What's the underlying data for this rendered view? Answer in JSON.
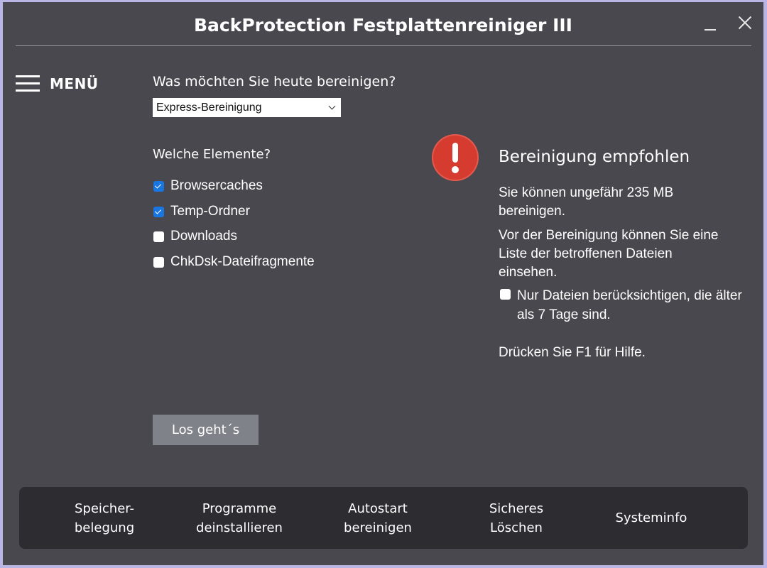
{
  "window": {
    "title": "BackProtection Festplattenreiniger III"
  },
  "menu": {
    "label": "MENÜ"
  },
  "main": {
    "question": "Was möchten Sie heute bereinigen?",
    "mode_select": {
      "value": "Express-Bereinigung"
    },
    "elements_heading": "Welche Elemente?",
    "elements": [
      {
        "label": "Browsercaches",
        "checked": true
      },
      {
        "label": "Temp-Ordner",
        "checked": true
      },
      {
        "label": "Downloads",
        "checked": false
      },
      {
        "label": "ChkDsk-Dateifragmente",
        "checked": false
      }
    ],
    "start_button": "Los geht´s"
  },
  "recommendation": {
    "icon": "exclamation-icon",
    "title": "Bereinigung empfohlen",
    "size_text": "Sie können ungefähr 235 MB bereinigen.",
    "list_text": "Vor der Bereinigung können Sie eine Liste der betroffenen Dateien einsehen.",
    "older_checkbox": {
      "label": "Nur Dateien berücksichtigen, die älter als 7 Tage sind.",
      "checked": false
    },
    "help_text": "Drücken Sie F1 für Hilfe."
  },
  "bottom_nav": [
    {
      "label": "Speicher-\nbelegung"
    },
    {
      "label": "Programme\ndeinstallieren"
    },
    {
      "label": "Autostart\nbereinigen"
    },
    {
      "label": "Sicheres\nLöschen"
    },
    {
      "label": "Systeminfo"
    }
  ],
  "colors": {
    "background": "#49484e",
    "accent_checkbox": "#1976e0",
    "alert": "#d63b2f",
    "bottom_bar": "#2d2c31",
    "button": "#7f8289"
  }
}
